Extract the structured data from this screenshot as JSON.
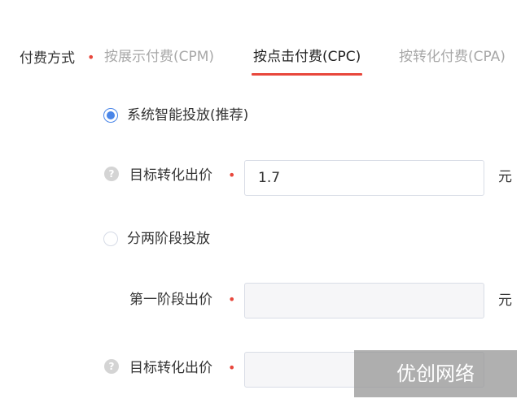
{
  "payment": {
    "label": "付费方式",
    "required_mark": "•",
    "tabs": [
      {
        "label": "按展示付费(CPM)",
        "active": false
      },
      {
        "label": "按点击付费(CPC)",
        "active": true
      },
      {
        "label": "按转化付费(CPA)",
        "active": false
      }
    ]
  },
  "options": {
    "smart": {
      "label": "系统智能投放(推荐)",
      "checked": true
    },
    "two_stage": {
      "label": "分两阶段投放",
      "checked": false
    }
  },
  "fields": {
    "target_bid_1": {
      "label": "目标转化出价",
      "required_mark": "•",
      "value": "1.7",
      "unit": "元",
      "help": "?"
    },
    "stage1_bid": {
      "label": "第一阶段出价",
      "required_mark": "•",
      "value": "",
      "unit": "元"
    },
    "target_bid_2": {
      "label": "目标转化出价",
      "required_mark": "•",
      "value": "",
      "help": "?"
    }
  },
  "watermark": "优创网络",
  "colors": {
    "accent_red": "#e8473c",
    "radio_blue": "#4a86e8",
    "inactive_tab": "#a8a8a8"
  }
}
